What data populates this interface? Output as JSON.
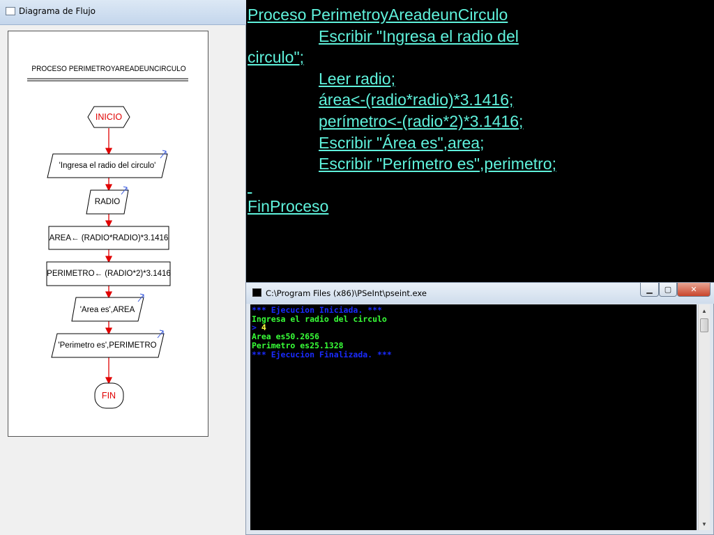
{
  "flowchart_window": {
    "title": "Diagrama de Flujo",
    "heading": "PROCESO PERIMETROYAREADEUNCIRCULO",
    "nodes": [
      {
        "text": "INICIO"
      },
      {
        "text": "'Ingresa el radio del circulo'"
      },
      {
        "text": "RADIO"
      },
      {
        "text": "AREA← (RADIO*RADIO)*3.1416"
      },
      {
        "text": "PERIMETRO← (RADIO*2)*3.1416"
      },
      {
        "text": "'Area es',AREA"
      },
      {
        "text": "'Perimetro es',PERIMETRO"
      },
      {
        "text": "FIN"
      }
    ],
    "colors": {
      "terminal": "#e00000",
      "arrow": "#e00000",
      "io_marker": "#3355dd"
    }
  },
  "pseudocode": {
    "lines": [
      {
        "indent": false,
        "text": "Proceso PerimetroyAreadeunCirculo"
      },
      {
        "indent": true,
        "text": "Escribir \"Ingresa el radio del"
      },
      {
        "indent": false,
        "text": "circulo\";"
      },
      {
        "indent": true,
        "text": "Leer radio;"
      },
      {
        "indent": true,
        "text": "área<-(radio*radio)*3.1416;"
      },
      {
        "indent": true,
        "text": "perímetro<-(radio*2)*3.1416;"
      },
      {
        "indent": true,
        "text": "Escribir \"Área es\",area;"
      },
      {
        "indent": true,
        "text": "Escribir \"Perímetro es\",perimetro;"
      },
      {
        "indent": false,
        "text": ""
      },
      {
        "indent": false,
        "text": "FinProceso"
      }
    ],
    "color": "#5ff2dc"
  },
  "console_window": {
    "title": "C:\\Program Files (x86)\\PSeInt\\pseint.exe",
    "buttons": {
      "minimize": "▁",
      "maximize": "▢",
      "close": "✕"
    },
    "lines": [
      {
        "text": "*** Ejecucion Iniciada. ***",
        "color": "#1a2bff"
      },
      {
        "text": "Ingresa el radio del circulo",
        "color": "#38ff38"
      },
      {
        "text": "> 4",
        "color": "#ffff40",
        "prompt_color": "#1a2bff"
      },
      {
        "text": "Area es50.2656",
        "color": "#38ff38"
      },
      {
        "text": "Perimetro es25.1328",
        "color": "#38ff38"
      },
      {
        "text": "*** Ejecucion Finalizada. ***",
        "color": "#1a2bff"
      }
    ]
  }
}
